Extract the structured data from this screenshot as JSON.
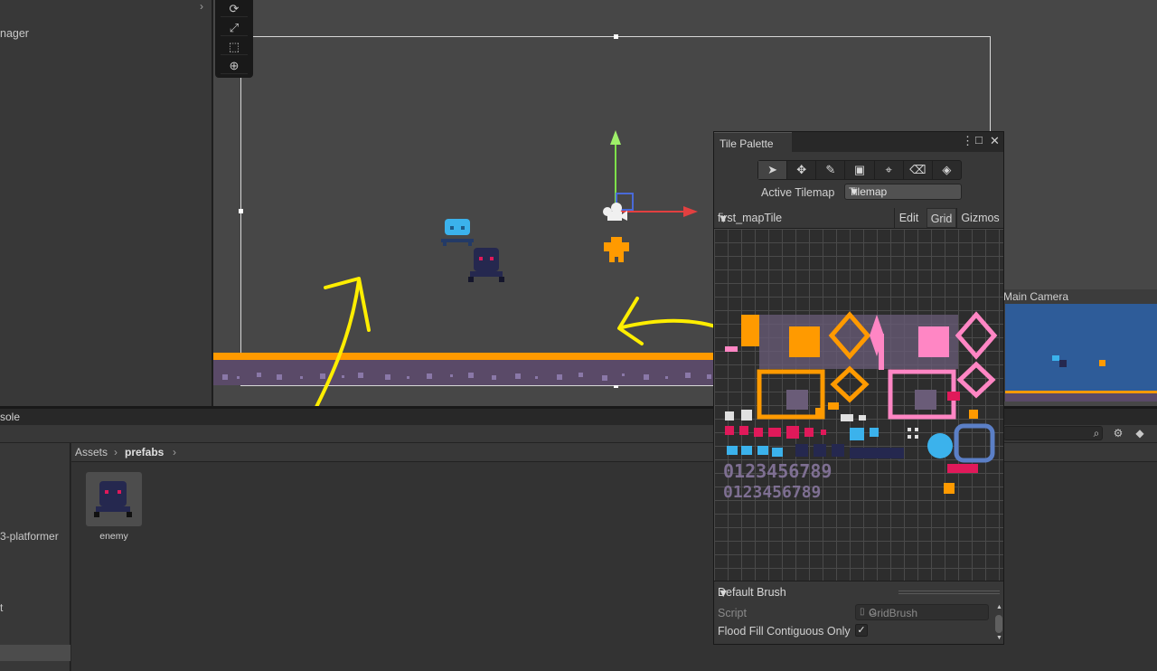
{
  "hierarchy": {
    "item_label": "nager",
    "expand_glyph": "›"
  },
  "scene_tools": [
    {
      "icon": "rotate-tool-icon",
      "glyph": "⟳"
    },
    {
      "icon": "scale-tool-icon",
      "glyph": "⤢"
    },
    {
      "icon": "rect-tool-icon",
      "glyph": "⬚"
    },
    {
      "icon": "transform-tool-icon",
      "glyph": "⊕"
    }
  ],
  "console": {
    "tab_label": "sole"
  },
  "project": {
    "left_items": [
      "3-platformer",
      "t"
    ],
    "breadcrumb": {
      "root": "Assets",
      "current": "prefabs",
      "separator": "›"
    },
    "assets": [
      {
        "name": "enemy"
      }
    ]
  },
  "main_camera": {
    "title": "Main Camera"
  },
  "tile_palette": {
    "title": "Tile Palette",
    "menu_glyph": "⋮",
    "maximize_glyph": "□",
    "close_glyph": "✕",
    "tools": [
      {
        "icon": "select-tool-icon",
        "glyph": "➤"
      },
      {
        "icon": "move-tool-icon",
        "glyph": "✥"
      },
      {
        "icon": "paint-brush-icon",
        "glyph": "✎"
      },
      {
        "icon": "box-fill-icon",
        "glyph": "▣"
      },
      {
        "icon": "picker-icon",
        "glyph": "⌖"
      },
      {
        "icon": "eraser-icon",
        "glyph": "⌫"
      },
      {
        "icon": "fill-bucket-icon",
        "glyph": "◈"
      }
    ],
    "active_tilemap_label": "Active Tilemap",
    "active_tilemap_value": "Tilemap",
    "palette_name": "first_mapTile",
    "edit_label": "Edit",
    "grid_label": "Grid",
    "gizmos_label": "Gizmos",
    "brush": "Default Brush",
    "script_label": "Script",
    "script_value": "GridBrush",
    "flood_fill_label": "Flood Fill Contiguous Only",
    "flood_fill_checked": true,
    "check_glyph": "✓",
    "dropdown_glyph": "▼"
  },
  "colors": {
    "accent_orange": "#ff9a00",
    "annotation_yellow": "#ffee00",
    "sky_blue": "#2e5c99"
  }
}
